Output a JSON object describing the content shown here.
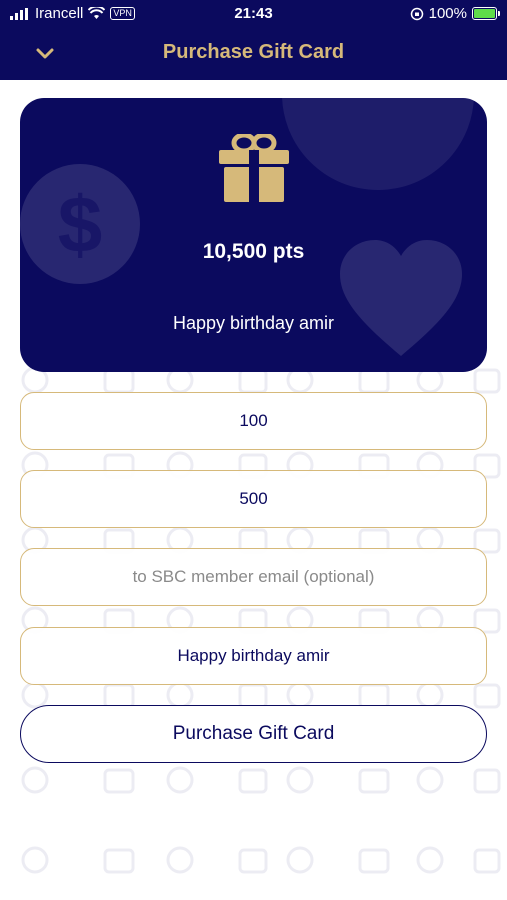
{
  "status_bar": {
    "carrier": "Irancell",
    "vpn": "VPN",
    "time": "21:43",
    "battery": "100%"
  },
  "nav": {
    "title": "Purchase Gift Card",
    "back_icon": "chevron-down-icon"
  },
  "gift_card": {
    "icon": "gift-icon",
    "points": "10,500 pts",
    "message": "Happy birthday amir",
    "background_color": "#0b0a5e",
    "accent_color": "#d6b97a"
  },
  "form": {
    "points_value": "100",
    "amount_value": "500",
    "email_placeholder": "to SBC member email (optional)",
    "message_value": "Happy birthday amir",
    "submit_label": "Purchase Gift Card"
  }
}
